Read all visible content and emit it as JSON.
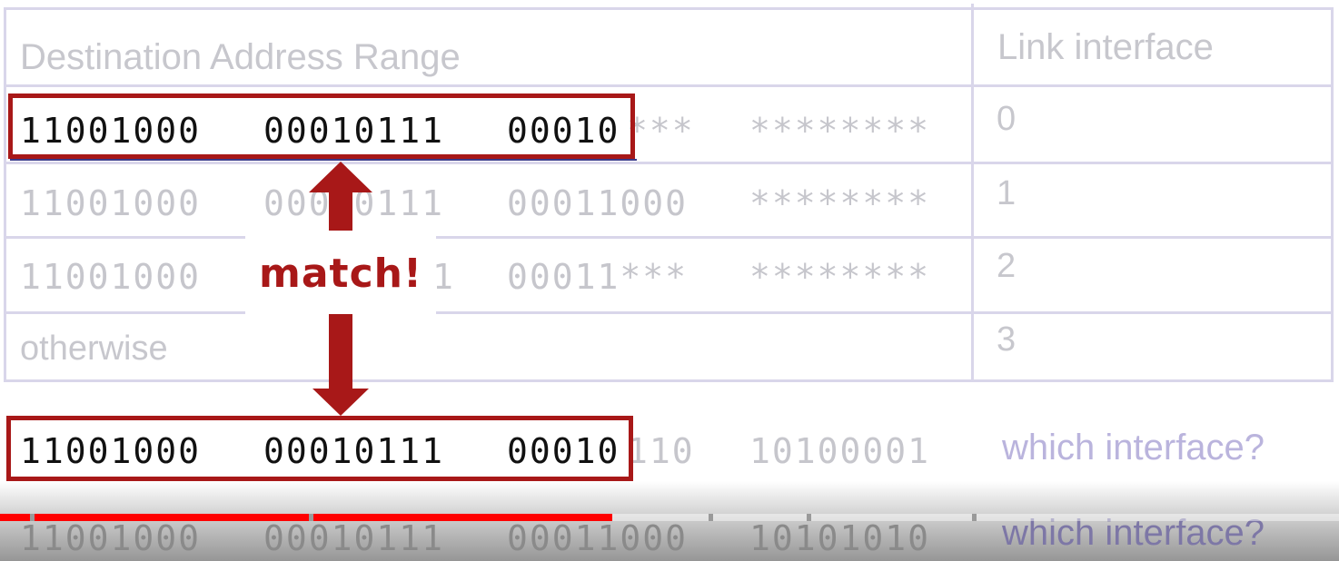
{
  "table": {
    "header": {
      "range_label": "Destination Address Range",
      "iface_label": "Link interface"
    },
    "rows": [
      {
        "b1": "11001000",
        "b2": "00010111",
        "b3_match": "00010",
        "b3_rest": "***",
        "b4": "********",
        "iface": "0"
      },
      {
        "b1": "11001000",
        "b2": "00010111",
        "b3": "00011000",
        "b4": "********",
        "iface": "1"
      },
      {
        "b1": "11001000",
        "b2_tail": "1",
        "b3": "00011***",
        "b4": "********",
        "iface": "2"
      },
      {
        "label": "otherwise",
        "iface": "3"
      }
    ]
  },
  "annotation": {
    "match_label": "match!"
  },
  "queries": [
    {
      "b1": "11001000",
      "b2": "00010111",
      "b3_match": "00010",
      "b3_rest": "110",
      "b4": "10100001",
      "question": "which interface?"
    },
    {
      "b1": "11001000",
      "b2": "00010111",
      "b3": "00011000",
      "b4": "10101010",
      "question": "which interface?"
    }
  ],
  "colors": {
    "highlight_red": "#a81818",
    "progress_red": "#ff0000",
    "grid_lavender": "#d9d6ea",
    "question_purple": "#bab4dd"
  },
  "video": {
    "progress_fraction": 0.457
  }
}
